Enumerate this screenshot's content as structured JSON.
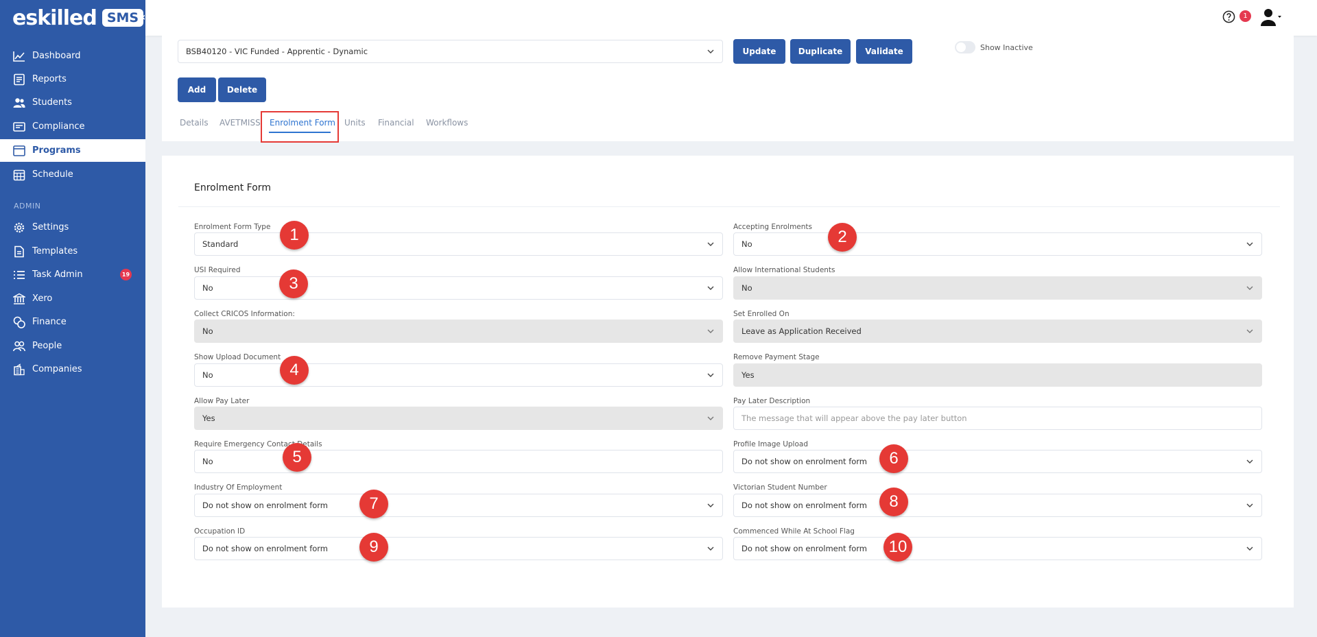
{
  "brand": {
    "logo_text": "eskilled",
    "logo_badge": "SMS",
    "collapse_icon": "double-chevron-left-icon"
  },
  "sidebar": {
    "items": [
      {
        "label": "Dashboard",
        "icon": "line-chart-icon"
      },
      {
        "label": "Reports",
        "icon": "report-icon"
      },
      {
        "label": "Students",
        "icon": "users-icon"
      },
      {
        "label": "Compliance",
        "icon": "id-card-icon"
      },
      {
        "label": "Programs",
        "icon": "browser-icon",
        "active": true
      },
      {
        "label": "Schedule",
        "icon": "calendar-icon"
      }
    ],
    "admin_heading": "ADMIN",
    "admin_items": [
      {
        "label": "Settings",
        "icon": "gear-icon"
      },
      {
        "label": "Templates",
        "icon": "document-icon"
      },
      {
        "label": "Task Admin",
        "icon": "list-icon",
        "badge": "19"
      },
      {
        "label": "Xero",
        "icon": "bank-icon"
      },
      {
        "label": "Finance",
        "icon": "coins-icon"
      },
      {
        "label": "People",
        "icon": "people-icon"
      },
      {
        "label": "Companies",
        "icon": "building-icon"
      }
    ]
  },
  "topbar": {
    "help_icon": "help-circle-icon",
    "notification_count": "1",
    "user_icon": "user-icon"
  },
  "program": {
    "selected": "BSB40120 - VIC Funded - Apprentic - Dynamic",
    "buttons": {
      "update": "Update",
      "duplicate": "Duplicate",
      "validate": "Validate",
      "add": "Add",
      "delete": "Delete"
    },
    "show_inactive_label": "Show Inactive",
    "show_inactive_on": false
  },
  "tabs": [
    "Details",
    "AVETMISS",
    "Enrolment Form",
    "Units",
    "Financial",
    "Workflows"
  ],
  "active_tab": "Enrolment Form",
  "form": {
    "title": "Enrolment Form",
    "fields": {
      "enrolment_form_type": {
        "label": "Enrolment Form Type",
        "value": "Standard"
      },
      "accepting_enrolments": {
        "label": "Accepting Enrolments",
        "value": "No"
      },
      "usi_required": {
        "label": "USI Required",
        "value": "No"
      },
      "allow_international": {
        "label": "Allow International Students",
        "value": "No"
      },
      "collect_cricos": {
        "label": "Collect CRICOS Information:",
        "value": "No"
      },
      "set_enrolled_on": {
        "label": "Set Enrolled On",
        "value": "Leave as Application Received"
      },
      "show_upload_document": {
        "label": "Show Upload Document",
        "value": "No"
      },
      "remove_payment_stage": {
        "label": "Remove Payment Stage",
        "value": "Yes"
      },
      "allow_pay_later": {
        "label": "Allow Pay Later",
        "value": "Yes"
      },
      "pay_later_description": {
        "label": "Pay Later Description",
        "placeholder": "The message that will appear above the pay later button"
      },
      "require_emergency": {
        "label": "Require Emergency Contact Details",
        "value": "No"
      },
      "profile_image_upload": {
        "label": "Profile Image Upload",
        "value": "Do not show on enrolment form"
      },
      "industry_of_employment": {
        "label": "Industry Of Employment",
        "value": "Do not show on enrolment form"
      },
      "victorian_student_number": {
        "label": "Victorian Student Number",
        "value": "Do not show on enrolment form"
      },
      "occupation_id": {
        "label": "Occupation ID",
        "value": "Do not show on enrolment form"
      },
      "commenced_while_at_school": {
        "label": "Commenced While At School Flag",
        "value": "Do not show on enrolment form"
      }
    }
  },
  "callouts": [
    "1",
    "2",
    "3",
    "4",
    "5",
    "6",
    "7",
    "8",
    "9",
    "10"
  ],
  "colors": {
    "primary": "#2e5aa7",
    "callout": "#e53935",
    "badge": "#e53950",
    "active_tab": "#2e74d0"
  }
}
